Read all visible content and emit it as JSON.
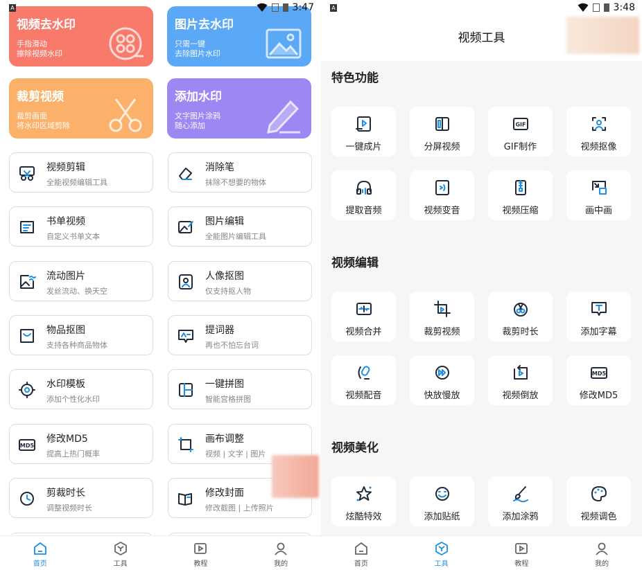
{
  "left": {
    "status_time": "3:47",
    "big_cards": [
      {
        "title": "视频去水印",
        "sub1": "手指滑动",
        "sub2": "擦除视频水印",
        "color": "#f77a6a"
      },
      {
        "title": "图片去水印",
        "sub1": "只需一键",
        "sub2": "去除图片水印",
        "color": "#5aa8f6"
      },
      {
        "title": "裁剪视频",
        "sub1": "裁剪画面",
        "sub2": "将水印区域剪除",
        "color": "#fbb169"
      },
      {
        "title": "添加水印",
        "sub1": "文字图片涂鸦",
        "sub2": "随心添加",
        "color": "#9d87f3"
      }
    ],
    "list": [
      {
        "title": "视频剪辑",
        "sub": "全能视频编辑工具",
        "icon": "scissors-icon"
      },
      {
        "title": "消除笔",
        "sub": "抹除不想要的物体",
        "icon": "eraser-icon"
      },
      {
        "title": "书单视频",
        "sub": "自定义书单文本",
        "icon": "book-list-icon"
      },
      {
        "title": "图片编辑",
        "sub": "全能图片编辑工具",
        "icon": "image-edit-icon"
      },
      {
        "title": "流动图片",
        "sub": "发丝流动、换天空",
        "icon": "flow-image-icon"
      },
      {
        "title": "人像抠图",
        "sub": "仅支持抠人物",
        "icon": "portrait-icon"
      },
      {
        "title": "物品抠图",
        "sub": "支持各种商品物体",
        "icon": "bag-icon"
      },
      {
        "title": "提词器",
        "sub": "再也不怕忘台词",
        "icon": "teleprompter-icon"
      },
      {
        "title": "水印模板",
        "sub": "添加个性化水印",
        "icon": "gear-icon"
      },
      {
        "title": "一键拼图",
        "sub": "智能宫格拼图",
        "icon": "collage-icon"
      },
      {
        "title": "修改MD5",
        "sub": "提高上热门概率",
        "icon": "md5-icon"
      },
      {
        "title": "画布调整",
        "sub": "视频 | 文字 | 图片",
        "icon": "canvas-icon"
      },
      {
        "title": "剪裁时长",
        "sub": "调整视频时长",
        "icon": "clock-icon"
      },
      {
        "title": "修改封面",
        "sub": "修改截图 | 上传照片",
        "icon": "cover-icon"
      }
    ],
    "nav": [
      "首页",
      "工具",
      "教程",
      "我的"
    ],
    "active_nav": 0
  },
  "right": {
    "status_time": "3:48",
    "title": "视频工具",
    "sections": [
      {
        "name": "特色功能",
        "items": [
          {
            "label": "一键成片",
            "icon": "one-click-icon"
          },
          {
            "label": "分屏视频",
            "icon": "split-screen-icon"
          },
          {
            "label": "GIF制作",
            "icon": "gif-icon"
          },
          {
            "label": "视频抠像",
            "icon": "matting-icon"
          },
          {
            "label": "提取音频",
            "icon": "headphones-icon"
          },
          {
            "label": "视频变音",
            "icon": "voice-change-icon"
          },
          {
            "label": "视频压缩",
            "icon": "compress-icon"
          },
          {
            "label": "画中画",
            "icon": "pip-icon"
          }
        ]
      },
      {
        "name": "视频编辑",
        "items": [
          {
            "label": "视频合并",
            "icon": "merge-icon"
          },
          {
            "label": "裁剪视频",
            "icon": "crop-icon"
          },
          {
            "label": "裁剪时长",
            "icon": "trim-icon"
          },
          {
            "label": "添加字幕",
            "icon": "subtitle-icon"
          },
          {
            "label": "视频配音",
            "icon": "dubbing-icon"
          },
          {
            "label": "快放慢放",
            "icon": "speed-icon"
          },
          {
            "label": "视频倒放",
            "icon": "reverse-icon"
          },
          {
            "label": "修改MD5",
            "icon": "md5-icon"
          }
        ]
      },
      {
        "name": "视频美化",
        "items": [
          {
            "label": "炫酷特效",
            "icon": "star-icon"
          },
          {
            "label": "添加贴纸",
            "icon": "sticker-icon"
          },
          {
            "label": "添加涂鸦",
            "icon": "brush-icon"
          },
          {
            "label": "视频调色",
            "icon": "palette-icon"
          }
        ]
      }
    ],
    "nav": [
      "首页",
      "工具",
      "教程",
      "我的"
    ],
    "active_nav": 1
  },
  "colors": {
    "accent": "#1a8fe3",
    "icon": "#1e2a3a"
  }
}
